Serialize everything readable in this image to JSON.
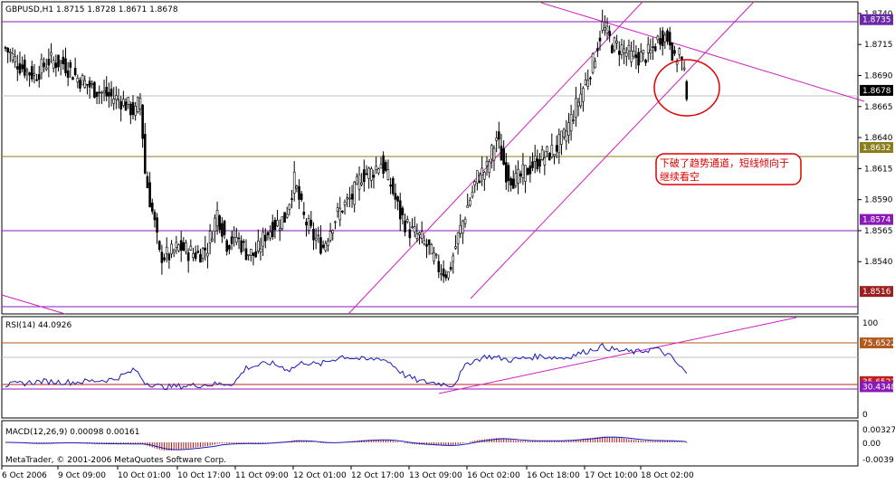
{
  "main": {
    "header": "GBPUSD,H1  1.8715 1.8728 1.8671 1.8678",
    "annotation_line1": "下破了趋势通道，短线倾向于",
    "annotation_line2": "继续看空",
    "price_ticks": [
      "1.8740",
      "1.8715",
      "1.8690",
      "1.8665",
      "1.8640",
      "1.8615",
      "1.8590",
      "1.8565",
      "1.8540"
    ],
    "level_tags": [
      {
        "label": "1.8735",
        "color": "#6a2aa8"
      },
      {
        "label": "1.8678",
        "color": "#000000"
      },
      {
        "label": "1.8632",
        "color": "#8b7d1b"
      },
      {
        "label": "1.8574",
        "color": "#8a1ab8"
      },
      {
        "label": "1.8516",
        "color": "#9c2020"
      }
    ],
    "colors": {
      "channel": "#d020c0",
      "horizontal_purple": "#8a1ab8",
      "horizontal_olive": "#8b7d1b",
      "circle": "#e00000",
      "candles": "#000000"
    }
  },
  "rsi": {
    "header": "RSI(14) 44.0926",
    "ticks": [
      "100",
      "0"
    ],
    "tags": [
      {
        "label": "75.6522",
        "color": "#b05a1e"
      },
      {
        "label": "35.6522",
        "color": "#c02020"
      },
      {
        "label": "30.4348",
        "color": "#8a1ab8"
      }
    ]
  },
  "macd": {
    "header": "MACD(12,26,9) 0.00098 0.00161",
    "ticks": [
      "0.00327",
      "0.00",
      "-0.0039"
    ]
  },
  "footer": {
    "copyright": "MetaTrader, © 2001-2006 MetaQuotes Software Corp.",
    "time_labels": [
      "6 Oct 2006",
      "9 Oct 09:00",
      "10 Oct 01:00",
      "10 Oct 17:00",
      "11 Oct 09:00",
      "12 Oct 01:00",
      "12 Oct 17:00",
      "13 Oct 09:00",
      "16 Oct 02:00",
      "16 Oct 18:00",
      "17 Oct 10:00",
      "18 Oct 02:00"
    ]
  },
  "chart_data": {
    "type": "candlestick",
    "title": "GBPUSD,H1",
    "ohlc_last": {
      "open": 1.8715,
      "high": 1.8728,
      "low": 1.8671,
      "close": 1.8678
    },
    "price_range": [
      1.8503,
      1.8745
    ],
    "close_path": [
      [
        0,
        1.8712
      ],
      [
        6,
        1.8698
      ],
      [
        12,
        1.869
      ],
      [
        18,
        1.8702
      ],
      [
        24,
        1.87
      ],
      [
        30,
        1.8688
      ],
      [
        36,
        1.868
      ],
      [
        42,
        1.8674
      ],
      [
        48,
        1.867
      ],
      [
        54,
        1.866
      ],
      [
        56,
        1.8672
      ],
      [
        58,
        1.8612
      ],
      [
        60,
        1.859
      ],
      [
        62,
        1.857
      ],
      [
        64,
        1.8545
      ],
      [
        68,
        1.8545
      ],
      [
        72,
        1.8552
      ],
      [
        76,
        1.8548
      ],
      [
        80,
        1.8546
      ],
      [
        84,
        1.8552
      ],
      [
        88,
        1.858
      ],
      [
        92,
        1.8555
      ],
      [
        96,
        1.856
      ],
      [
        100,
        1.8548
      ],
      [
        104,
        1.8545
      ],
      [
        108,
        1.8562
      ],
      [
        112,
        1.857
      ],
      [
        116,
        1.8575
      ],
      [
        120,
        1.8605
      ],
      [
        124,
        1.8575
      ],
      [
        128,
        1.856
      ],
      [
        132,
        1.8552
      ],
      [
        136,
        1.8572
      ],
      [
        140,
        1.8584
      ],
      [
        144,
        1.8592
      ],
      [
        148,
        1.861
      ],
      [
        152,
        1.8612
      ],
      [
        156,
        1.862
      ],
      [
        160,
        1.8602
      ],
      [
        164,
        1.8578
      ],
      [
        168,
        1.8565
      ],
      [
        172,
        1.856
      ],
      [
        176,
        1.855
      ],
      [
        180,
        1.8535
      ],
      [
        184,
        1.853
      ],
      [
        188,
        1.856
      ],
      [
        192,
        1.8585
      ],
      [
        196,
        1.8608
      ],
      [
        200,
        1.8615
      ],
      [
        204,
        1.864
      ],
      [
        208,
        1.8612
      ],
      [
        212,
        1.8605
      ],
      [
        216,
        1.8612
      ],
      [
        220,
        1.862
      ],
      [
        224,
        1.8625
      ],
      [
        228,
        1.863
      ],
      [
        232,
        1.864
      ],
      [
        236,
        1.866
      ],
      [
        240,
        1.868
      ],
      [
        244,
        1.87
      ],
      [
        248,
        1.873
      ],
      [
        252,
        1.8715
      ],
      [
        256,
        1.8712
      ],
      [
        260,
        1.8705
      ],
      [
        264,
        1.8705
      ],
      [
        268,
        1.8708
      ],
      [
        272,
        1.8722
      ],
      [
        276,
        1.872
      ],
      [
        278,
        1.87
      ],
      [
        280,
        1.871
      ],
      [
        283,
        1.8678
      ]
    ],
    "levels": [
      1.8735,
      1.8678,
      1.8632,
      1.8574,
      1.8516
    ],
    "rsi": {
      "current": 44.0926,
      "levels": [
        75.6522,
        35.6522,
        30.4348
      ],
      "path": [
        [
          0,
          32
        ],
        [
          15,
          36
        ],
        [
          28,
          35
        ],
        [
          45,
          38
        ],
        [
          54,
          48
        ],
        [
          58,
          35
        ],
        [
          65,
          30
        ],
        [
          80,
          32
        ],
        [
          95,
          34
        ],
        [
          100,
          50
        ],
        [
          110,
          55
        ],
        [
          118,
          48
        ],
        [
          124,
          56
        ],
        [
          130,
          53
        ],
        [
          140,
          62
        ],
        [
          150,
          58
        ],
        [
          156,
          60
        ],
        [
          160,
          55
        ],
        [
          166,
          42
        ],
        [
          172,
          36
        ],
        [
          180,
          34
        ],
        [
          186,
          32
        ],
        [
          192,
          55
        ],
        [
          200,
          62
        ],
        [
          210,
          58
        ],
        [
          222,
          62
        ],
        [
          232,
          60
        ],
        [
          240,
          66
        ],
        [
          248,
          72
        ],
        [
          254,
          68
        ],
        [
          262,
          66
        ],
        [
          270,
          70
        ],
        [
          276,
          62
        ],
        [
          283,
          44
        ]
      ]
    },
    "macd": {
      "main": 0.00098,
      "signal": 0.00161,
      "ylim": [
        -0.0039,
        0.00327
      ]
    }
  }
}
